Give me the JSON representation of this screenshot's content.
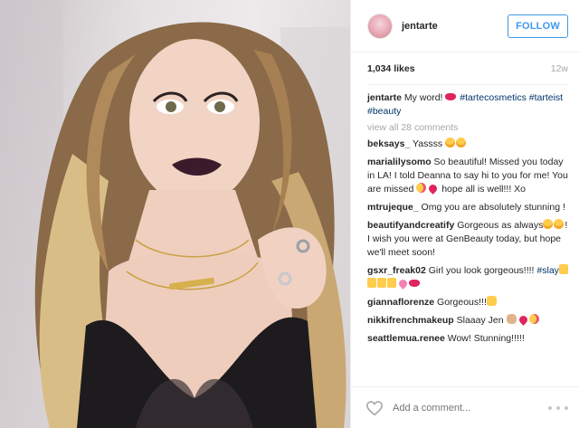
{
  "post": {
    "username": "jentarte",
    "follow_label": "FOLLOW",
    "likes": "1,034 likes",
    "age": "12w",
    "caption": {
      "text": "My word!",
      "tags": [
        "#tartecosmetics",
        "#tarteist",
        "#beauty"
      ]
    },
    "view_all": "view all 28 comments",
    "comments": [
      {
        "user": "beksays_",
        "text": "Yassss"
      },
      {
        "user": "marialilysomo",
        "text": "So beautiful! Missed you today in LA! I told Deanna to say hi to you for me! You are missed",
        "text2": "hope all is well!!! Xo"
      },
      {
        "user": "mtrujeque_",
        "text": "Omg you are absolutely stunning !"
      },
      {
        "user": "beautifyandcreatify",
        "text": "Gorgeous as always",
        "text2": "! I wish you were at GenBeauty today, but hope we'll meet soon!"
      },
      {
        "user": "gsxr_freak02",
        "text": "Girl you look gorgeous!!!!",
        "tag": "#slay"
      },
      {
        "user": "giannaflorenze",
        "text": "Gorgeous!!!"
      },
      {
        "user": "nikkifrenchmakeup",
        "text": "Slaaay Jen"
      },
      {
        "user": "seattlemua.renee",
        "text": "Wow! Stunning!!!!!"
      }
    ],
    "add_comment_placeholder": "Add a comment...",
    "icons": {
      "like": "heart-outline-icon",
      "more": "ellipsis-icon"
    },
    "colors": {
      "accent": "#3f99ed",
      "hashtag": "#003569",
      "muted": "#a5a7aa"
    }
  }
}
